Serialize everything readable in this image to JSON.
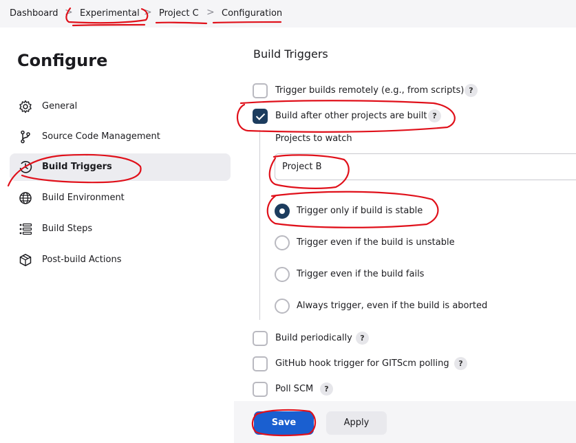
{
  "breadcrumb": {
    "items": [
      "Dashboard",
      "Experimental",
      "Project C",
      "Configuration"
    ],
    "separator": ">"
  },
  "sidebar": {
    "title": "Configure",
    "items": [
      {
        "label": "General",
        "icon": "gear-icon"
      },
      {
        "label": "Source Code Management",
        "icon": "branch-icon"
      },
      {
        "label": "Build Triggers",
        "icon": "clock-icon",
        "active": true
      },
      {
        "label": "Build Environment",
        "icon": "globe-icon"
      },
      {
        "label": "Build Steps",
        "icon": "list-icon"
      },
      {
        "label": "Post-build Actions",
        "icon": "package-icon"
      }
    ]
  },
  "main": {
    "section_title": "Build Triggers",
    "triggers": [
      {
        "label": "Trigger builds remotely (e.g., from scripts)",
        "checked": false
      },
      {
        "label": "Build after other projects are built",
        "checked": true
      },
      {
        "label": "Build periodically",
        "checked": false
      },
      {
        "label": "GitHub hook trigger for GITScm polling",
        "checked": false
      },
      {
        "label": "Poll SCM",
        "checked": false
      }
    ],
    "help_label": "?",
    "projects_to_watch": {
      "label": "Projects to watch",
      "value": "Project B"
    },
    "radio_options": [
      {
        "label": "Trigger only if build is stable",
        "selected": true
      },
      {
        "label": "Trigger even if the build is unstable",
        "selected": false
      },
      {
        "label": "Trigger even if the build fails",
        "selected": false
      },
      {
        "label": "Always trigger, even if the build is aborted",
        "selected": false
      }
    ]
  },
  "actions": {
    "save_label": "Save",
    "apply_label": "Apply"
  },
  "colors": {
    "accent": "#1a5fd0",
    "checked": "#1c3c5e",
    "annotation": "#e0101a"
  }
}
